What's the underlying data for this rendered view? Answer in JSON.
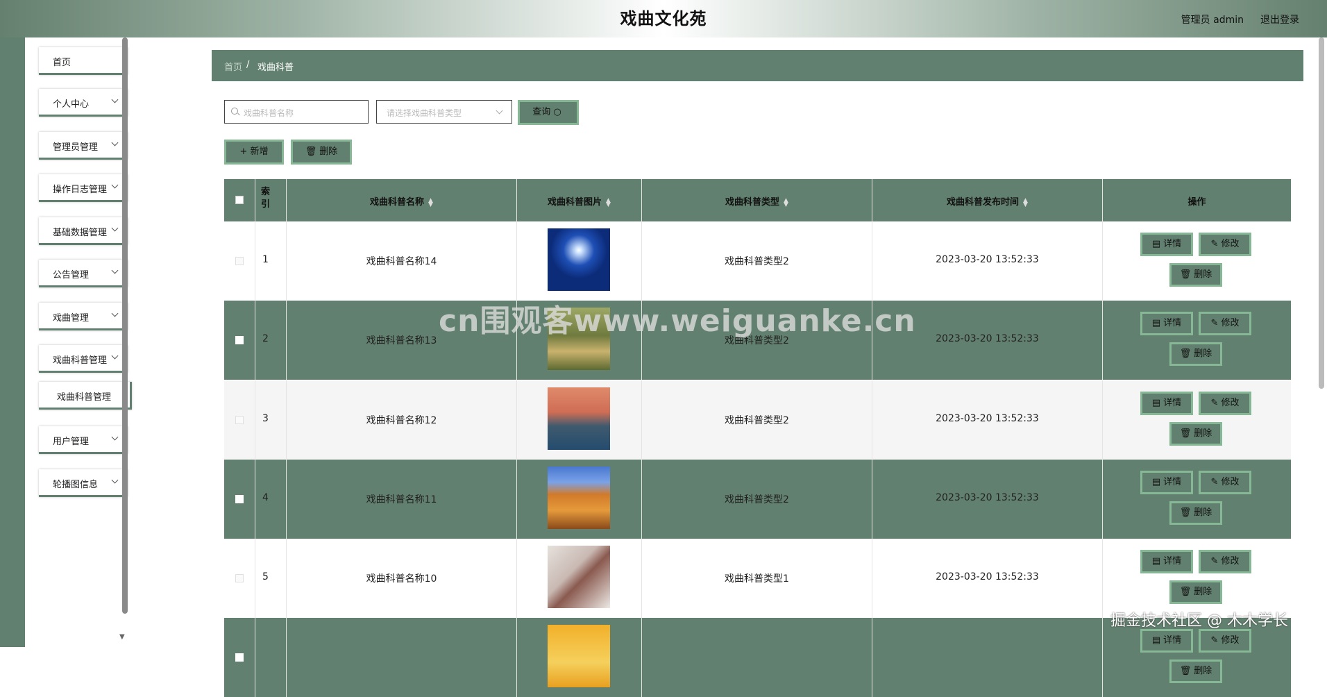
{
  "header": {
    "title": "戏曲文化苑",
    "user_label": "管理员 admin",
    "logout_label": "退出登录"
  },
  "sidebar": {
    "items": [
      {
        "label": "首页"
      },
      {
        "label": "个人中心"
      },
      {
        "label": "管理员管理"
      },
      {
        "label": "操作日志管理"
      },
      {
        "label": "基础数据管理"
      },
      {
        "label": "公告管理"
      },
      {
        "label": "戏曲管理"
      },
      {
        "label": "戏曲科普管理"
      },
      {
        "label": "戏曲科普管理"
      },
      {
        "label": "用户管理"
      },
      {
        "label": "轮播图信息"
      }
    ]
  },
  "breadcrumb": {
    "home": "首页",
    "separator": "/",
    "current": "戏曲科普"
  },
  "search": {
    "name_placeholder": "戏曲科普名称",
    "type_placeholder": "请选择戏曲科普类型",
    "query_label": "查询"
  },
  "toolbar": {
    "add_label": "新增",
    "delete_label": "删除"
  },
  "table": {
    "headers": {
      "index": "索引",
      "name": "戏曲科普名称",
      "image": "戏曲科普图片",
      "type": "戏曲科普类型",
      "time": "戏曲科普发布时间",
      "actions": "操作"
    },
    "action_labels": {
      "detail": "详情",
      "edit": "修改",
      "delete": "删除"
    },
    "rows": [
      {
        "index": "1",
        "name": "戏曲科普名称14",
        "type": "戏曲科普类型2",
        "time": "2023-03-20 13:52:33"
      },
      {
        "index": "2",
        "name": "戏曲科普名称13",
        "type": "戏曲科普类型2",
        "time": "2023-03-20 13:52:33"
      },
      {
        "index": "3",
        "name": "戏曲科普名称12",
        "type": "戏曲科普类型2",
        "time": "2023-03-20 13:52:33"
      },
      {
        "index": "4",
        "name": "戏曲科普名称11",
        "type": "戏曲科普类型2",
        "time": "2023-03-20 13:52:33"
      },
      {
        "index": "5",
        "name": "戏曲科普名称10",
        "type": "戏曲科普类型1",
        "time": "2023-03-20 13:52:33"
      },
      {
        "index": "",
        "name": "",
        "type": "",
        "time": ""
      }
    ]
  },
  "watermarks": {
    "center": "cn围观客www.weiguanke.cn",
    "corner": "掘金技术社区 @ 木木学长"
  },
  "colors": {
    "theme": "#62806f",
    "button_border": "#86b896"
  }
}
